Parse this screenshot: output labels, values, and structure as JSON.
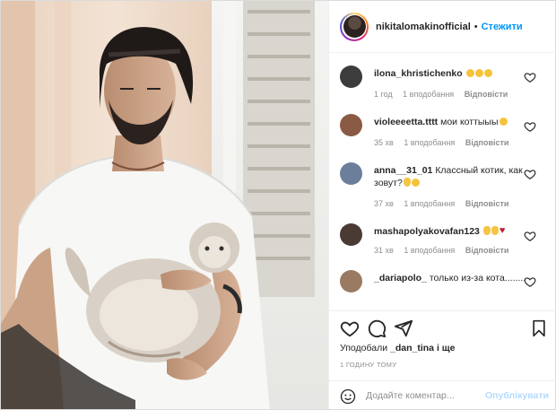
{
  "header": {
    "username": "nikitalomakinofficial",
    "separator": "•",
    "follow_label": "Стежити"
  },
  "comments": [
    {
      "username": "ilona_khristichenko",
      "text": "",
      "emojis": [
        "smile",
        "smile",
        "smile"
      ],
      "time": "1 год",
      "likes": "1 вподобання",
      "reply": "Відповісти",
      "avatar_color": "#3c3c3c"
    },
    {
      "username": "violeeeetta.tttt",
      "text": "мои коттыыы",
      "emojis": [
        "smile"
      ],
      "time": "35 хв",
      "likes": "1 вподобання",
      "reply": "Відповісти",
      "avatar_color": "#8a5a44"
    },
    {
      "username": "anna__31_01",
      "text": "Классный котик, как зовут?",
      "emojis": [
        "hand",
        "smile"
      ],
      "time": "37 хв",
      "likes": "1 вподобання",
      "reply": "Відповісти",
      "avatar_color": "#6b7f9a"
    },
    {
      "username": "mashapolyakovafan123",
      "text": "",
      "emojis": [
        "hand",
        "hand",
        "heart"
      ],
      "time": "31 хв",
      "likes": "1 вподобання",
      "reply": "Відповісти",
      "avatar_color": "#4a3a34"
    },
    {
      "username": "_dariapolo_",
      "text": "только из-за кота........",
      "emojis": [],
      "time": "",
      "likes": "",
      "reply": "",
      "avatar_color": "#9a7a62"
    }
  ],
  "actions": {
    "likes_prefix": "Уподобали",
    "likes_user": "_dan_tina",
    "likes_suffix": "і ще",
    "time_ago": "1 ГОДИНУ ТОМУ"
  },
  "add_comment": {
    "placeholder": "Додайте коментар...",
    "publish_label": "Опублікувати"
  },
  "colors": {
    "accent": "#0095f6",
    "publish_disabled": "#b3dbff",
    "secondary_text": "#8e8e8e"
  }
}
